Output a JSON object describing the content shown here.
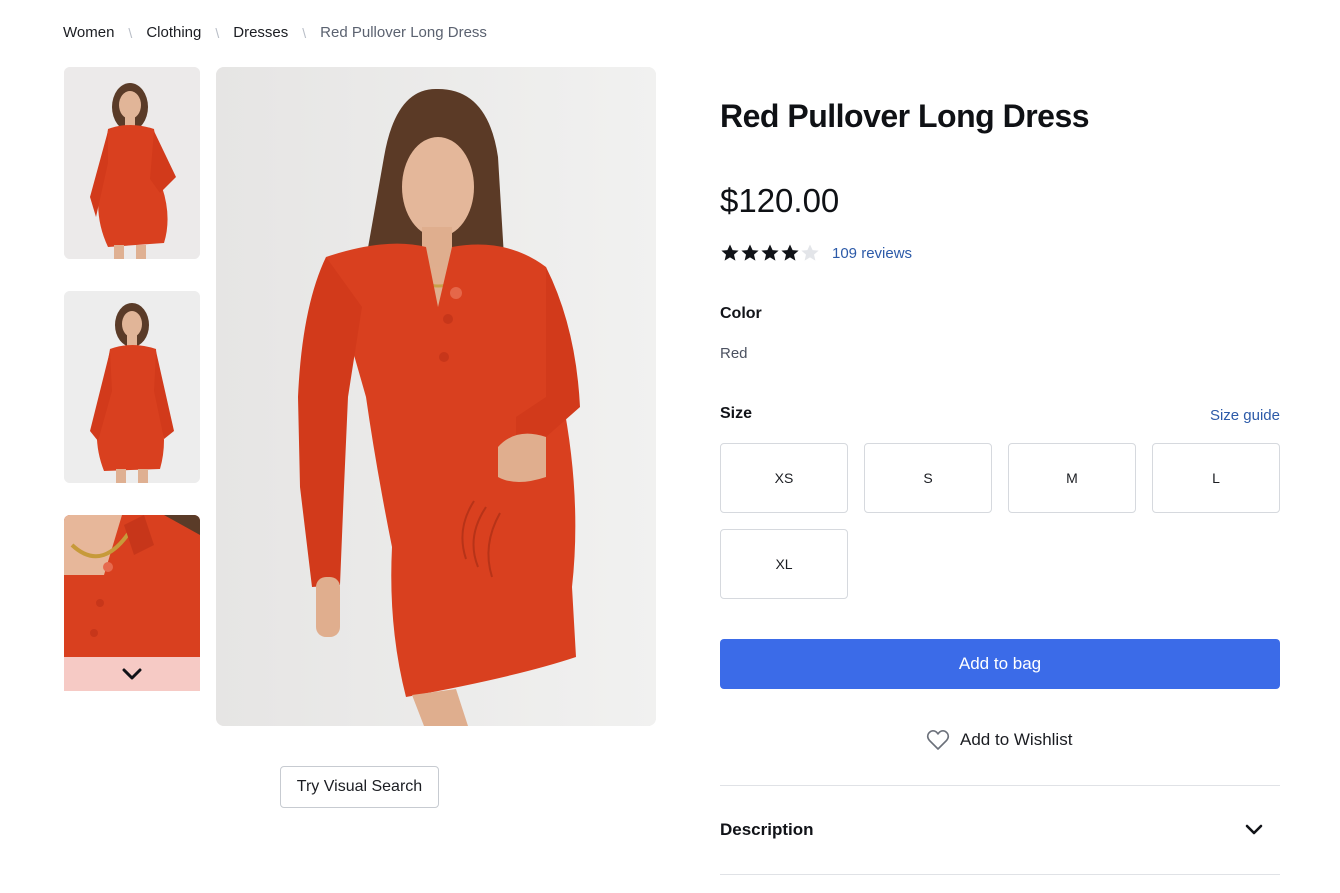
{
  "breadcrumb": {
    "items": [
      "Women",
      "Clothing",
      "Dresses"
    ],
    "current": "Red Pullover Long Dress",
    "separator": "\\"
  },
  "gallery": {
    "thumbnails": [
      "thumbnail-1",
      "thumbnail-2",
      "thumbnail-3"
    ],
    "next_icon": "chevron-down-icon",
    "visual_search_label": "Try Visual Search"
  },
  "product": {
    "title": "Red Pullover Long Dress",
    "price": "$120.00",
    "rating": 4,
    "rating_max": 5,
    "reviews_label": "109 reviews",
    "color_label": "Color",
    "color_value": "Red",
    "size_label": "Size",
    "size_guide_label": "Size guide",
    "sizes": [
      "XS",
      "S",
      "M",
      "L",
      "XL"
    ],
    "add_to_bag_label": "Add to bag",
    "wishlist_label": "Add to Wishlist",
    "description_label": "Description"
  },
  "colors": {
    "accent": "#3b6be8",
    "link": "#2c5aa8",
    "dress": "#d9401f",
    "star_filled": "#111318",
    "star_empty": "#e3e5e9"
  }
}
